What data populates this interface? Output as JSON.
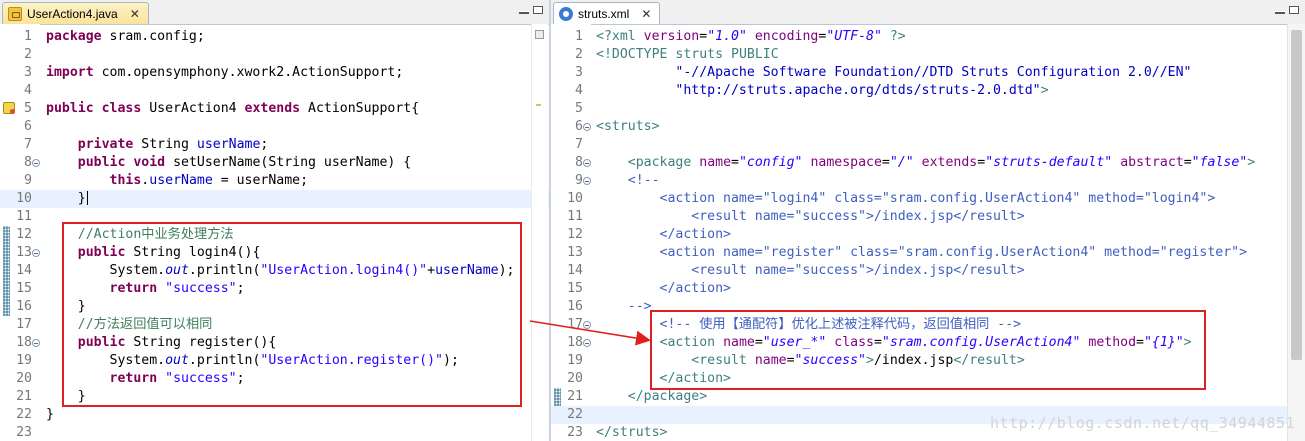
{
  "left_editor": {
    "tab_label": "UserAction4.java",
    "tab_icon": "java-file-icon",
    "close_glyph": "✕",
    "lines": [
      {
        "n": "1",
        "fold": false,
        "hl": false,
        "mark": false,
        "html": "<span class=\"kw\">package</span> sram.config;"
      },
      {
        "n": "2",
        "fold": false,
        "hl": false,
        "mark": false,
        "html": ""
      },
      {
        "n": "3",
        "fold": false,
        "hl": false,
        "mark": false,
        "html": "<span class=\"kw\">import</span> com.opensymphony.xwork2.ActionSupport;"
      },
      {
        "n": "4",
        "fold": false,
        "hl": false,
        "mark": false,
        "html": ""
      },
      {
        "n": "5",
        "fold": false,
        "hl": false,
        "mark": true,
        "html": "<span class=\"kw\">public</span> <span class=\"kw\">class</span> UserAction4 <span class=\"kw\">extends</span> ActionSupport{"
      },
      {
        "n": "6",
        "fold": false,
        "hl": false,
        "mark": false,
        "html": ""
      },
      {
        "n": "7",
        "fold": false,
        "hl": false,
        "mark": false,
        "html": "    <span class=\"kw\">private</span> String <span class=\"fld\">userName</span>;"
      },
      {
        "n": "8",
        "fold": true,
        "hl": false,
        "mark": false,
        "html": "    <span class=\"kw\">public</span> <span class=\"kw\">void</span> setUserName(String userName) {"
      },
      {
        "n": "9",
        "fold": false,
        "hl": false,
        "mark": false,
        "html": "        <span class=\"kw\">this</span>.<span class=\"fld\">userName</span> = userName;"
      },
      {
        "n": "10",
        "fold": false,
        "hl": true,
        "mark": false,
        "html": "    }<span class=\"caret\"></span>"
      },
      {
        "n": "11",
        "fold": false,
        "hl": false,
        "mark": false,
        "html": ""
      },
      {
        "n": "12",
        "fold": false,
        "hl": false,
        "mark": false,
        "html": "    <span class=\"cm\">//Action中业务处理方法</span>"
      },
      {
        "n": "13",
        "fold": true,
        "hl": false,
        "mark": false,
        "html": "    <span class=\"kw\">public</span> String login4(){"
      },
      {
        "n": "14",
        "fold": false,
        "hl": false,
        "mark": false,
        "html": "        System.<span class=\"fld it\">out</span>.println(<span class=\"st\">\"UserAction.login4()\"</span>+<span class=\"fld\">userName</span>);"
      },
      {
        "n": "15",
        "fold": false,
        "hl": false,
        "mark": false,
        "html": "        <span class=\"kw\">return</span> <span class=\"st\">\"success\"</span>;"
      },
      {
        "n": "16",
        "fold": false,
        "hl": false,
        "mark": false,
        "html": "    }"
      },
      {
        "n": "17",
        "fold": false,
        "hl": false,
        "mark": false,
        "html": "    <span class=\"cm\">//方法返回值可以相同</span>"
      },
      {
        "n": "18",
        "fold": true,
        "hl": false,
        "mark": false,
        "html": "    <span class=\"kw\">public</span> String register(){"
      },
      {
        "n": "19",
        "fold": false,
        "hl": false,
        "mark": false,
        "html": "        System.<span class=\"fld it\">out</span>.println(<span class=\"st\">\"UserAction.register()\"</span>);"
      },
      {
        "n": "20",
        "fold": false,
        "hl": false,
        "mark": false,
        "html": "        <span class=\"kw\">return</span> <span class=\"st\">\"success\"</span>;"
      },
      {
        "n": "21",
        "fold": false,
        "hl": false,
        "mark": false,
        "html": "    }"
      },
      {
        "n": "22",
        "fold": false,
        "hl": false,
        "mark": false,
        "html": "}"
      },
      {
        "n": "23",
        "fold": false,
        "hl": false,
        "mark": false,
        "html": ""
      }
    ]
  },
  "right_editor": {
    "tab_label": "struts.xml",
    "tab_icon": "xml-file-icon",
    "close_glyph": "✕",
    "lines": [
      {
        "n": "1",
        "fold": false,
        "hl": false,
        "html": "<span class=\"xt\">&lt;?xml</span> <span class=\"xa\">version</span>=<span class=\"xv\">\"1.0\"</span> <span class=\"xa\">encoding</span>=<span class=\"xv\">\"UTF-8\"</span> <span class=\"xt\">?&gt;</span>"
      },
      {
        "n": "2",
        "fold": false,
        "hl": false,
        "html": "<span class=\"xt\">&lt;!DOCTYPE</span> <span class=\"xt\">struts</span> <span class=\"xt\">PUBLIC</span>"
      },
      {
        "n": "3",
        "fold": false,
        "hl": false,
        "html": "          <span class=\"xs\">\"-//Apache Software Foundation//DTD Struts Configuration 2.0//EN\"</span>"
      },
      {
        "n": "4",
        "fold": false,
        "hl": false,
        "html": "          <span class=\"xs\">\"http://struts.apache.org/dtds/struts-2.0.dtd\"</span><span class=\"xt\">&gt;</span>"
      },
      {
        "n": "5",
        "fold": false,
        "hl": false,
        "html": ""
      },
      {
        "n": "6",
        "fold": true,
        "hl": false,
        "html": "<span class=\"xt\">&lt;struts&gt;</span>"
      },
      {
        "n": "7",
        "fold": false,
        "hl": false,
        "html": ""
      },
      {
        "n": "8",
        "fold": true,
        "hl": false,
        "html": "    <span class=\"xt\">&lt;package</span> <span class=\"xa\">name</span>=<span class=\"xv\">\"config\"</span> <span class=\"xa\">namespace</span>=<span class=\"xv\">\"/\"</span> <span class=\"xa\">extends</span>=<span class=\"xv\">\"struts-default\"</span> <span class=\"xa\">abstract</span>=<span class=\"xv\">\"false\"</span><span class=\"xt\">&gt;</span>"
      },
      {
        "n": "9",
        "fold": true,
        "hl": false,
        "html": "    <span class=\"xc\">&lt;!--</span>"
      },
      {
        "n": "10",
        "fold": false,
        "hl": false,
        "html": "        <span class=\"xc\">&lt;action name=\"login4\" class=\"sram.config.UserAction4\" method=\"login4\"&gt;</span>"
      },
      {
        "n": "11",
        "fold": false,
        "hl": false,
        "html": "            <span class=\"xc\">&lt;result name=\"success\"&gt;/index.jsp&lt;/result&gt;</span>"
      },
      {
        "n": "12",
        "fold": false,
        "hl": false,
        "html": "        <span class=\"xc\">&lt;/action&gt;</span>"
      },
      {
        "n": "13",
        "fold": false,
        "hl": false,
        "html": "        <span class=\"xc\">&lt;action name=\"register\" class=\"sram.config.UserAction4\" method=\"register\"&gt;</span>"
      },
      {
        "n": "14",
        "fold": false,
        "hl": false,
        "html": "            <span class=\"xc\">&lt;result name=\"success\"&gt;/index.jsp&lt;/result&gt;</span>"
      },
      {
        "n": "15",
        "fold": false,
        "hl": false,
        "html": "        <span class=\"xc\">&lt;/action&gt;</span>"
      },
      {
        "n": "16",
        "fold": false,
        "hl": false,
        "html": "    <span class=\"xc\">--&gt;</span>"
      },
      {
        "n": "17",
        "fold": true,
        "hl": false,
        "html": "        <span class=\"xc\">&lt;!-- 使用【通配符】优化上述被注释代码，返回值相同 --&gt;</span>"
      },
      {
        "n": "18",
        "fold": true,
        "hl": false,
        "html": "        <span class=\"xt\">&lt;action</span> <span class=\"xa\">name</span>=<span class=\"xv\">\"user_*\"</span> <span class=\"xa\">class</span>=<span class=\"xv\">\"sram.config.UserAction4\"</span> <span class=\"xa\">method</span>=<span class=\"xv\">\"{1}\"</span><span class=\"xt\">&gt;</span>"
      },
      {
        "n": "19",
        "fold": false,
        "hl": false,
        "html": "            <span class=\"xt\">&lt;result</span> <span class=\"xa\">name</span>=<span class=\"xv\">\"success\"</span><span class=\"xt\">&gt;</span>/index.jsp<span class=\"xt\">&lt;/result&gt;</span>"
      },
      {
        "n": "20",
        "fold": false,
        "hl": false,
        "html": "        <span class=\"xt\">&lt;/action&gt;</span>"
      },
      {
        "n": "21",
        "fold": false,
        "hl": false,
        "html": "    <span class=\"xt\">&lt;/package&gt;</span>"
      },
      {
        "n": "22",
        "fold": false,
        "hl": true,
        "html": ""
      },
      {
        "n": "23",
        "fold": false,
        "hl": false,
        "html": "<span class=\"xt\">&lt;/struts&gt;</span>"
      }
    ]
  },
  "watermark": "http://blog.csdn.net/qq_34944851",
  "colors": {
    "annotation_box": "#e02020",
    "current_line": "#e8f2fe",
    "keyword": "#7f0055",
    "string": "#2a00ff",
    "comment": "#3f7f5f",
    "xml_tag": "#3f7f7f",
    "xml_attr": "#7f007f"
  }
}
